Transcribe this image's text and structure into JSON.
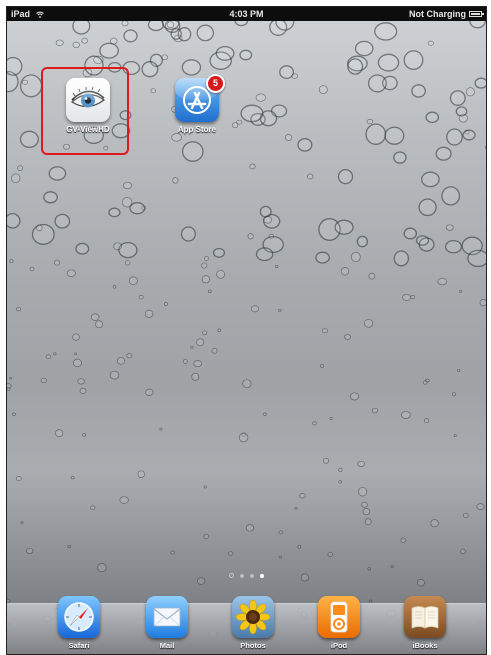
{
  "status_bar": {
    "device": "iPad",
    "time": "4:03 PM",
    "battery_text": "Not Charging"
  },
  "home_apps": [
    {
      "label": "GV-ViewHD",
      "icon": "eye-icon"
    },
    {
      "label": "App Store",
      "icon": "app-store-icon",
      "badge": "5"
    }
  ],
  "page_indicator": {
    "pages": 3,
    "current": 1,
    "has_search_page": true
  },
  "dock": [
    {
      "label": "Safari",
      "icon": "safari-compass-icon"
    },
    {
      "label": "Mail",
      "icon": "mail-envelope-icon"
    },
    {
      "label": "Photos",
      "icon": "sunflower-photo-icon"
    },
    {
      "label": "iPod",
      "icon": "ipod-icon"
    },
    {
      "label": "iBooks",
      "icon": "open-book-icon"
    }
  ],
  "colors": {
    "highlight": "#e01a1a",
    "badge": "#d71919"
  }
}
